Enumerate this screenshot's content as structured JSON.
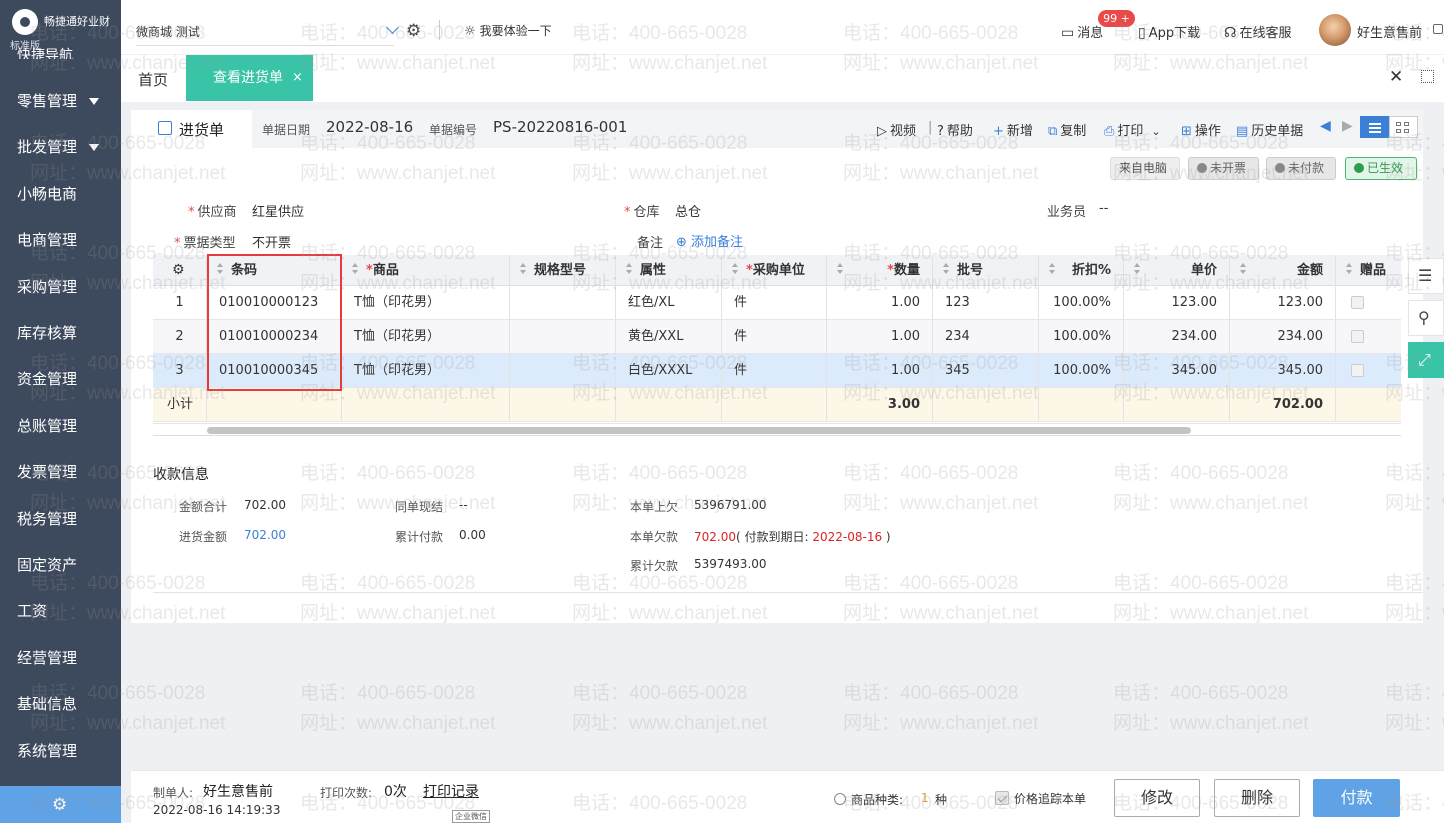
{
  "sidebar": {
    "brand_name": "畅捷通好业财",
    "edition": "标准版",
    "partial_item": "快捷导航",
    "items": [
      {
        "label": "零售管理",
        "has_caret": true
      },
      {
        "label": "批发管理",
        "has_caret": true
      },
      {
        "label": "小畅电商",
        "has_caret": false
      },
      {
        "label": "电商管理",
        "has_caret": false
      },
      {
        "label": "采购管理",
        "has_caret": false
      },
      {
        "label": "库存核算",
        "has_caret": false
      },
      {
        "label": "资金管理",
        "has_caret": false
      },
      {
        "label": "总账管理",
        "has_caret": false
      },
      {
        "label": "发票管理",
        "has_caret": false
      },
      {
        "label": "税务管理",
        "has_caret": false
      },
      {
        "label": "固定资产",
        "has_caret": false
      },
      {
        "label": "工资",
        "has_caret": false
      },
      {
        "label": "经营管理",
        "has_caret": false
      },
      {
        "label": "基础信息",
        "has_caret": false
      },
      {
        "label": "系统管理",
        "has_caret": false
      }
    ],
    "settings_icon": "gear-icon"
  },
  "topbar": {
    "store": "微商城 测试",
    "try_label": "我要体验一下",
    "messages_label": "消息",
    "messages_badge": "99 +",
    "app_download": "App下载",
    "support": "在线客服",
    "user_name": "好生意售前"
  },
  "tabs": {
    "home": "首页",
    "active": "查看进货单",
    "close_glyph": "×"
  },
  "doc": {
    "tab_label": "进货单",
    "date_label": "单据日期",
    "date": "2022-08-16",
    "number_label": "单据编号",
    "number": "PS-20220816-001",
    "toolbar": {
      "video": "视频",
      "help": "帮助",
      "add": "新增",
      "copy": "复制",
      "print": "打印",
      "ops": "操作",
      "history": "历史单据"
    },
    "status": {
      "source": "来自电脑",
      "invoice": "未开票",
      "payment": "未付款",
      "valid": "已生效"
    },
    "fields": {
      "supplier_label": "供应商",
      "supplier": "红星供应",
      "warehouse_label": "仓库",
      "warehouse": "总仓",
      "salesman_label": "业务员",
      "salesman": "--",
      "invoice_type_label": "票据类型",
      "invoice_type": "不开票",
      "remark_label": "备注",
      "remark_add": "添加备注"
    }
  },
  "table": {
    "headers": {
      "barcode": "条码",
      "product": "商品",
      "spec": "规格型号",
      "attr": "属性",
      "unit": "采购单位",
      "qty": "数量",
      "batch": "批号",
      "discount": "折扣%",
      "price": "单价",
      "amount": "金额",
      "gift": "赠品"
    },
    "rows": [
      {
        "no": "1",
        "barcode": "010010000123",
        "product": "T恤（印花男）",
        "spec": "",
        "attr": "红色/XL",
        "unit": "件",
        "qty": "1.00",
        "batch": "123",
        "discount": "100.00%",
        "price": "123.00",
        "amount": "123.00"
      },
      {
        "no": "2",
        "barcode": "010010000234",
        "product": "T恤（印花男）",
        "spec": "",
        "attr": "黄色/XXL",
        "unit": "件",
        "qty": "1.00",
        "batch": "234",
        "discount": "100.00%",
        "price": "234.00",
        "amount": "234.00"
      },
      {
        "no": "3",
        "barcode": "010010000345",
        "product": "T恤（印花男）",
        "spec": "",
        "attr": "白色/XXXL",
        "unit": "件",
        "qty": "1.00",
        "batch": "345",
        "discount": "100.00%",
        "price": "345.00",
        "amount": "345.00"
      }
    ],
    "total": {
      "label": "小计",
      "qty": "3.00",
      "amount": "702.00"
    }
  },
  "payment": {
    "title": "收款信息",
    "total_label": "金额合计",
    "total": "702.00",
    "purchase_label": "进货金额",
    "purchase": "702.00",
    "cash_label": "同单现结",
    "cash": "--",
    "paid_label": "累计付款",
    "paid": "0.00",
    "prev_owed_label": "本单上欠",
    "prev_owed": "5396791.00",
    "owed_label": "本单欠款",
    "owed": "702.00",
    "due_prefix": "( 付款到期日: ",
    "due_date": "2022-08-16",
    "due_suffix": " )",
    "cum_owed_label": "累计欠款",
    "cum_owed": "5397493.00"
  },
  "bottom": {
    "creator_label": "制单人:",
    "creator": "好生意售前",
    "created_at": "2022-08-16 14:19:33",
    "print_count_label": "打印次数:",
    "print_count": "0次",
    "print_log": "打印记录",
    "wechat_tag": "企业微信",
    "kinds_label": "商品种类:",
    "kinds_value": "1",
    "kinds_unit": "种",
    "price_track": "价格追踪本单",
    "edit": "修改",
    "delete": "删除",
    "pay": "付款"
  },
  "watermark": {
    "phone": "电话：400-665-0028",
    "site": "网址：www.chanjet.net"
  },
  "colors": {
    "sidebar": "#3d4a5d",
    "accent_green": "#39c4a8",
    "accent_blue": "#3a80d8",
    "required_red": "#e84a4a"
  }
}
